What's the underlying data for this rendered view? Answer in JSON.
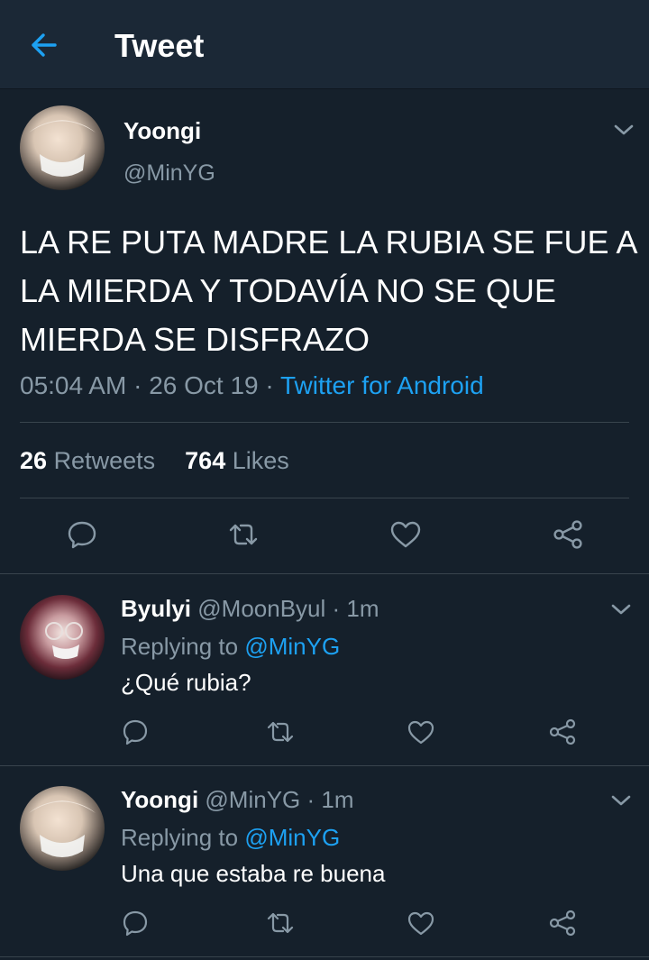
{
  "header": {
    "title": "Tweet"
  },
  "tweet": {
    "name": "Yoongi",
    "handle": "@MinYG",
    "text": "LA RE PUTA MADRE LA RUBIA SE FUE A LA MIERDA Y TODAVÍA NO SE QUE MIERDA SE DISFRAZO",
    "time": "05:04 AM",
    "date": "26 Oct 19",
    "source": "Twitter for Android",
    "retweets_count": "26",
    "retweets_label": "Retweets",
    "likes_count": "764",
    "likes_label": "Likes"
  },
  "replies": [
    {
      "name": "Byulyi",
      "handle": "@MoonByul",
      "time": "1m",
      "replying_prefix": "Replying to",
      "replying_to": "@MinYG",
      "text": "¿Qué rubia?"
    },
    {
      "name": "Yoongi",
      "handle": "@MinYG",
      "time": "1m",
      "replying_prefix": "Replying to",
      "replying_to": "@MinYG",
      "text": "Una que estaba re buena"
    }
  ],
  "separator": "·",
  "colors": {
    "background": "#15202b",
    "header": "#1b2836",
    "accent": "#1da1f2",
    "muted": "#8899a6",
    "border": "#38444d"
  },
  "icons": [
    "back-arrow-icon",
    "chevron-down-icon",
    "reply-icon",
    "retweet-icon",
    "like-icon",
    "share-icon"
  ]
}
